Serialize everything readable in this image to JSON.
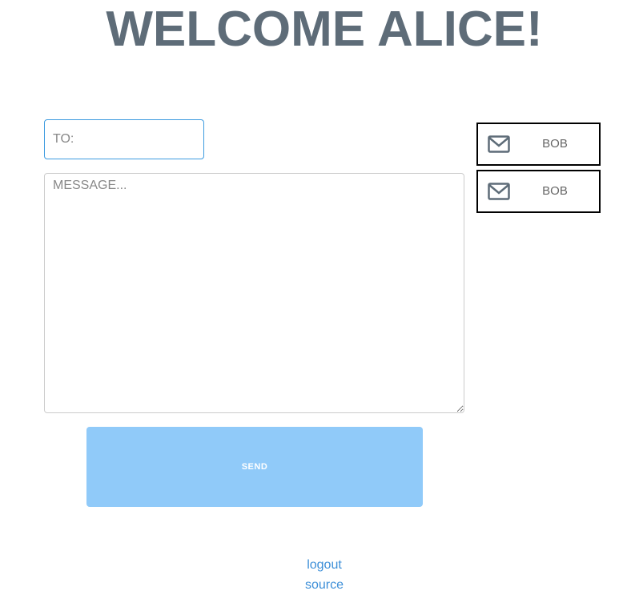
{
  "header": {
    "title": "WELCOME ALICE!"
  },
  "compose": {
    "to_placeholder": "TO:",
    "to_value": "",
    "message_placeholder": "MESSAGE...",
    "message_value": "",
    "send_label": "SEND"
  },
  "contacts": [
    {
      "name": "BOB",
      "icon": "mail-icon"
    },
    {
      "name": "BOB",
      "icon": "mail-icon"
    }
  ],
  "footer": {
    "logout_label": "logout",
    "source_label": "source"
  },
  "colors": {
    "title": "#5e6c78",
    "send_button": "#90caf9",
    "link": "#3d8fd8",
    "focus_border": "#3d9be0"
  }
}
